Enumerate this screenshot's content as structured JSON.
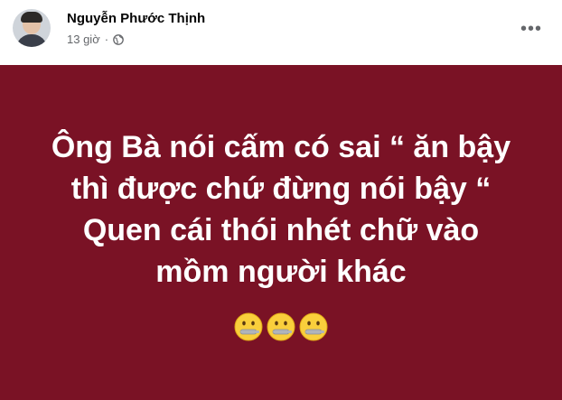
{
  "post": {
    "author": "Nguyễn Phước Thịnh",
    "time": "13 giờ",
    "separator": "·",
    "privacy_icon": "globe-icon",
    "more_icon": "more-options-icon",
    "more_label": "•••"
  },
  "status": {
    "background_color": "#7a1225",
    "text_color": "#ffffff",
    "lines": [
      "Ông Bà nói cấm có sai “ ăn bậy",
      "thì được chứ đừng nói bậy “",
      "Quen cái thói nhét chữ vào",
      "mồm người khác"
    ],
    "emojis": [
      "zipper-mouth-face",
      "zipper-mouth-face",
      "zipper-mouth-face"
    ]
  }
}
